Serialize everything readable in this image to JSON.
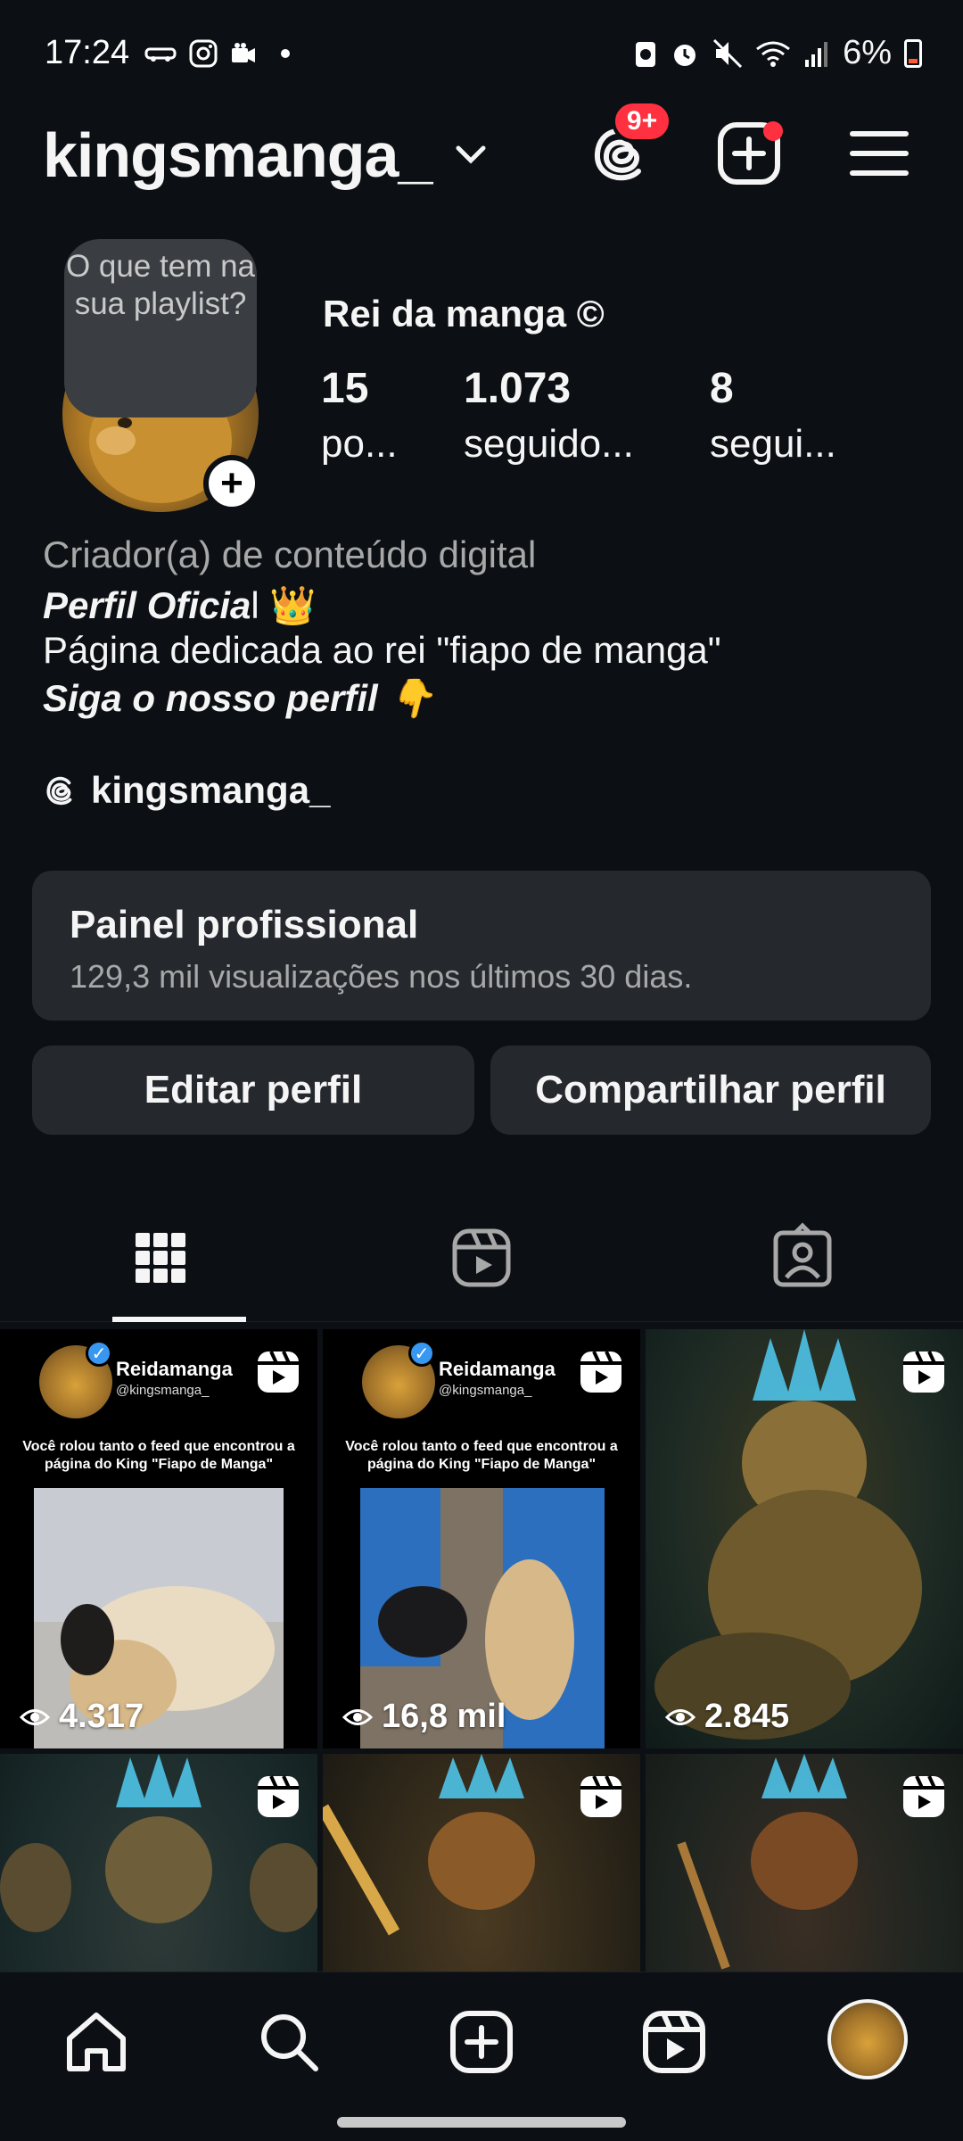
{
  "status_bar": {
    "time": "17:24",
    "battery": "6%",
    "left_icons": [
      "car-icon",
      "instagram-icon",
      "video-icon",
      "dot-icon"
    ],
    "right_icons": [
      "battery-saver-icon",
      "alarm-icon",
      "mute-icon",
      "wifi-icon",
      "signal-icon"
    ]
  },
  "header": {
    "username": "kingsmanga_",
    "threads_badge": "9+",
    "accent_color": "#ff3040"
  },
  "profile": {
    "note": "O que tem na sua playlist?",
    "display_name": "Rei da manga ©",
    "stats": [
      {
        "value": "15",
        "label": "po..."
      },
      {
        "value": "1.073",
        "label": "seguido..."
      },
      {
        "value": "8",
        "label": "segui..."
      }
    ]
  },
  "bio": {
    "category": "Criador(a) de conteúdo digital",
    "line1_bold": "Perfil Oficia",
    "line1_rest": "l 👑",
    "line2": "Página dedicada ao rei \"fiapo de manga\"",
    "line3": "Siga o nosso perfil 👇",
    "threads_handle": "kingsmanga_"
  },
  "dashboard": {
    "title": "Painel profissional",
    "subtitle": "129,3 mil visualizações nos últimos 30 dias."
  },
  "buttons": {
    "edit": "Editar perfil",
    "share": "Compartilhar perfil"
  },
  "tabs": [
    "grid",
    "reels",
    "tagged"
  ],
  "posts": [
    {
      "views": "4.317",
      "name": "Reidamanga",
      "handle": "@kingsmanga_",
      "caption": "Você rolou tanto o feed que encontrou a página do King \"Fiapo de Manga\""
    },
    {
      "views": "16,8 mil",
      "name": "Reidamanga",
      "handle": "@kingsmanga_",
      "caption": "Você rolou tanto o feed que encontrou a página do King \"Fiapo de Manga\""
    },
    {
      "views": "2.845"
    },
    {
      "views": ""
    },
    {
      "views": ""
    },
    {
      "views": ""
    }
  ],
  "bottom_nav": [
    "home",
    "search",
    "create",
    "reels",
    "profile"
  ]
}
